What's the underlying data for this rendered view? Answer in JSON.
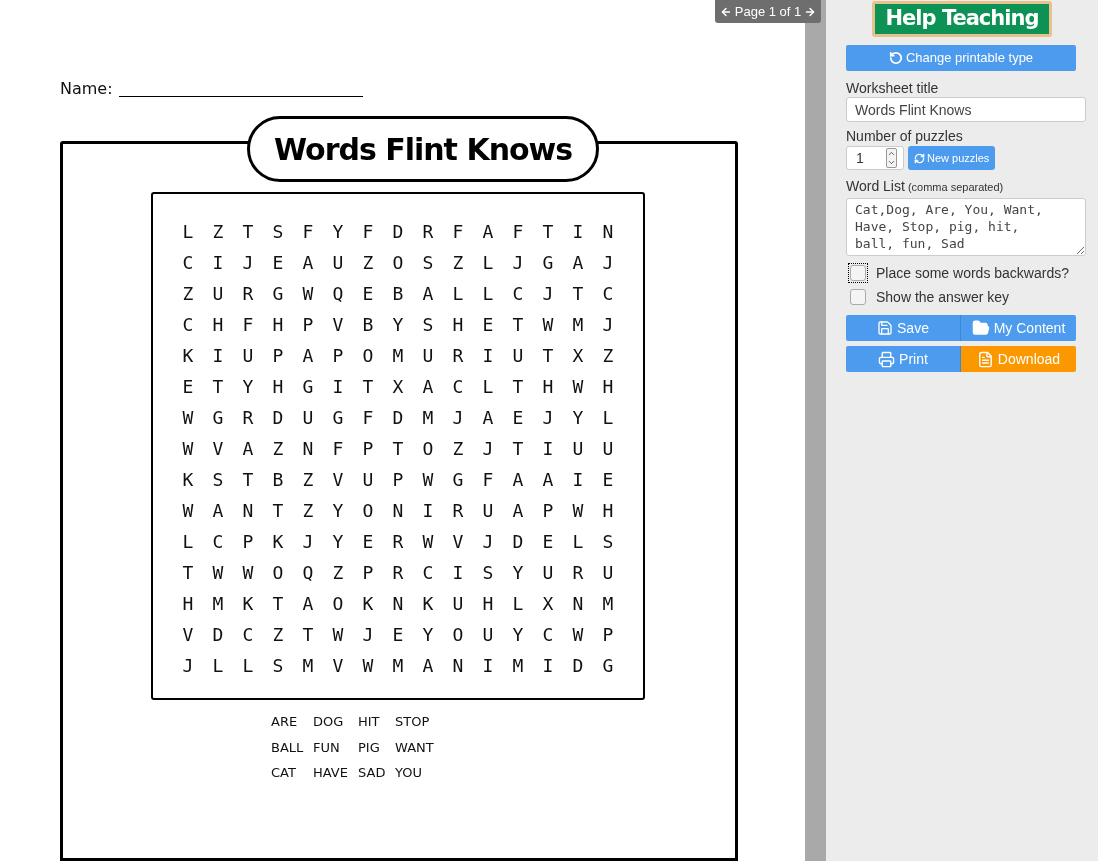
{
  "pager": {
    "label": "Page 1 of 1"
  },
  "worksheet": {
    "name_label": "Name:",
    "title": "Words Flint Knows",
    "grid": [
      [
        "L",
        "Z",
        "T",
        "S",
        "F",
        "Y",
        "F",
        "D",
        "R",
        "F",
        "A",
        "F",
        "T",
        "I",
        "N"
      ],
      [
        "C",
        "I",
        "J",
        "E",
        "A",
        "U",
        "Z",
        "O",
        "S",
        "Z",
        "L",
        "J",
        "G",
        "A",
        "J"
      ],
      [
        "Z",
        "U",
        "R",
        "G",
        "W",
        "Q",
        "E",
        "B",
        "A",
        "L",
        "L",
        "C",
        "J",
        "T",
        "C"
      ],
      [
        "C",
        "H",
        "F",
        "H",
        "P",
        "V",
        "B",
        "Y",
        "S",
        "H",
        "E",
        "T",
        "W",
        "M",
        "J"
      ],
      [
        "K",
        "I",
        "U",
        "P",
        "A",
        "P",
        "O",
        "M",
        "U",
        "R",
        "I",
        "U",
        "T",
        "X",
        "Z"
      ],
      [
        "E",
        "T",
        "Y",
        "H",
        "G",
        "I",
        "T",
        "X",
        "A",
        "C",
        "L",
        "T",
        "H",
        "W",
        "H"
      ],
      [
        "W",
        "G",
        "R",
        "D",
        "U",
        "G",
        "F",
        "D",
        "M",
        "J",
        "A",
        "E",
        "J",
        "Y",
        "L"
      ],
      [
        "W",
        "V",
        "A",
        "Z",
        "N",
        "F",
        "P",
        "T",
        "O",
        "Z",
        "J",
        "T",
        "I",
        "U",
        "U"
      ],
      [
        "K",
        "S",
        "T",
        "B",
        "Z",
        "V",
        "U",
        "P",
        "W",
        "G",
        "F",
        "A",
        "A",
        "I",
        "E"
      ],
      [
        "W",
        "A",
        "N",
        "T",
        "Z",
        "Y",
        "O",
        "N",
        "I",
        "R",
        "U",
        "A",
        "P",
        "W",
        "H"
      ],
      [
        "L",
        "C",
        "P",
        "K",
        "J",
        "Y",
        "E",
        "R",
        "W",
        "V",
        "J",
        "D",
        "E",
        "L",
        "S"
      ],
      [
        "T",
        "W",
        "W",
        "O",
        "Q",
        "Z",
        "P",
        "R",
        "C",
        "I",
        "S",
        "Y",
        "U",
        "R",
        "U"
      ],
      [
        "H",
        "M",
        "K",
        "T",
        "A",
        "O",
        "K",
        "N",
        "K",
        "U",
        "H",
        "L",
        "X",
        "N",
        "M"
      ],
      [
        "V",
        "D",
        "C",
        "Z",
        "T",
        "W",
        "J",
        "E",
        "Y",
        "O",
        "U",
        "Y",
        "C",
        "W",
        "P"
      ],
      [
        "J",
        "L",
        "L",
        "S",
        "M",
        "V",
        "W",
        "M",
        "A",
        "N",
        "I",
        "M",
        "I",
        "D",
        "G"
      ]
    ],
    "word_bank": [
      [
        "ARE",
        "DOG",
        "HIT",
        "STOP"
      ],
      [
        "BALL",
        "FUN",
        "PIG",
        "WANT"
      ],
      [
        "CAT",
        "HAVE",
        "SAD",
        "YOU"
      ]
    ]
  },
  "sidebar": {
    "logo": "Help Teaching",
    "change_button": "Change printable type",
    "title_label": "Worksheet title",
    "title_value": "Words Flint Knows",
    "count_label": "Number of puzzles",
    "count_value": "1",
    "new_button": "New puzzles",
    "list_label": "Word List",
    "list_hint": "(comma separated)",
    "list_value": "Cat,Dog, Are, You, Want, Have, Stop, pig, hit, ball, fun, Sad",
    "options": [
      {
        "label": "Place some words backwards?",
        "checked": false,
        "focused": true
      },
      {
        "label": "Show the answer key",
        "checked": false,
        "focused": false
      }
    ],
    "actions": [
      {
        "label": "Save",
        "kind": "save"
      },
      {
        "label": "My Content",
        "kind": "folder"
      },
      {
        "label": "Print",
        "kind": "print"
      },
      {
        "label": "Download",
        "kind": "download"
      }
    ]
  }
}
